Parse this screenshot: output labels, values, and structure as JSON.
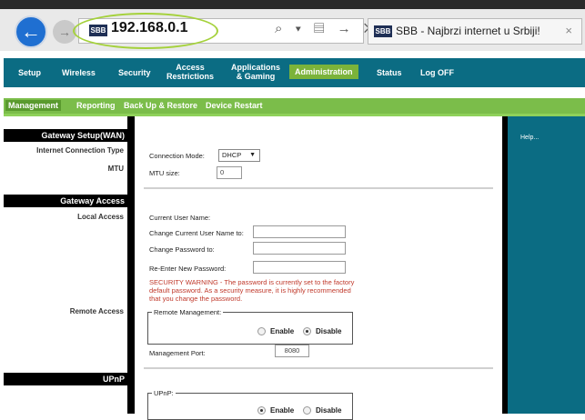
{
  "browser": {
    "url": "192.168.0.1",
    "favicon_text": "SBB",
    "tab_title": "SBB - Najbrzi internet u Srbiji!",
    "url_actions": "⌕ ▾ ▤ → ✕",
    "tab_close": "×",
    "back_glyph": "←",
    "forward_glyph": "→"
  },
  "nav": {
    "items": [
      "Setup",
      "Wireless",
      "Security",
      "Access Restrictions",
      "Applications & Gaming",
      "Administration",
      "Status",
      "Log OFF"
    ],
    "active": "Administration"
  },
  "subnav": {
    "items": [
      "Management",
      "Reporting",
      "Back Up & Restore",
      "Device Restart"
    ],
    "active": "Management"
  },
  "left": {
    "gateway_setup_wan": "Gateway Setup(WAN)",
    "internet_connection_type": "Internet Connection Type",
    "mtu": "MTU",
    "gateway_access": "Gateway Access",
    "local_access": "Local Access",
    "remote_access": "Remote Access",
    "upnp": "UPnP"
  },
  "main": {
    "connection_mode_label": "Connection Mode:",
    "connection_mode_value": "DHCP",
    "mtu_size_label": "MTU size:",
    "mtu_size_value": "0",
    "current_user_name_label": "Current User Name:",
    "change_user_name_label": "Change Current User Name to:",
    "change_password_label": "Change Password to:",
    "reenter_password_label": "Re-Enter New Password:",
    "security_warning": "SECURITY WARNING - The password is currently set to the factory default password. As a security measure, it is highly recommended that you change the password.",
    "remote_management_legend": "Remote Management:",
    "remote_enable": "Enable",
    "remote_disable": "Disable",
    "remote_selected": "Disable",
    "management_port_label": "Management Port:",
    "management_port_value": "8080",
    "upnp_legend": "UPnP:",
    "upnp_enable": "Enable",
    "upnp_disable": "Disable",
    "upnp_selected": "Enable"
  },
  "right": {
    "help": "Help..."
  },
  "colors": {
    "nav_bg": "#0b6c83",
    "nav_active": "#7bb33a",
    "subnav_bg": "#7bbd4a",
    "warning": "#c0392b",
    "back_button": "#1f6fd1"
  }
}
